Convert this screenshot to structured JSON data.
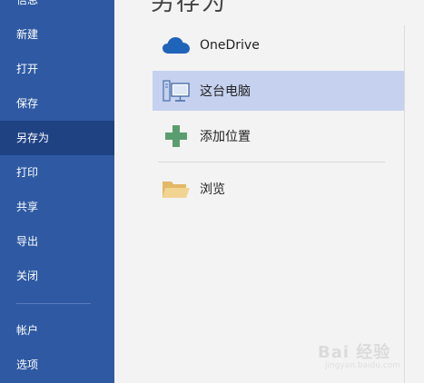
{
  "sidebar": {
    "items": [
      {
        "label": "信息",
        "active": false
      },
      {
        "label": "新建",
        "active": false
      },
      {
        "label": "打开",
        "active": false
      },
      {
        "label": "保存",
        "active": false
      },
      {
        "label": "另存为",
        "active": true
      },
      {
        "label": "打印",
        "active": false
      },
      {
        "label": "共享",
        "active": false
      },
      {
        "label": "导出",
        "active": false
      },
      {
        "label": "关闭",
        "active": false
      },
      {
        "label": "帐户",
        "active": false
      },
      {
        "label": "选项",
        "active": false
      }
    ]
  },
  "main": {
    "title": "另存为",
    "places": [
      {
        "label": "OneDrive",
        "icon": "cloud-icon",
        "selected": false
      },
      {
        "label": "这台电脑",
        "icon": "computer-icon",
        "selected": true
      },
      {
        "label": "添加位置",
        "icon": "plus-icon",
        "selected": false
      },
      {
        "label": "浏览",
        "icon": "folder-icon",
        "selected": false
      }
    ]
  },
  "watermark": {
    "brand": "Bai 经验",
    "url": "jingyan.baidu.com"
  },
  "colors": {
    "sidebar_bg": "#2f5aa3",
    "sidebar_active": "#1f4283",
    "selected_place": "#c5d1ef",
    "onedrive_blue": "#2064b9",
    "plus_green": "#5a9e6f",
    "folder_yellow": "#e8c277"
  }
}
